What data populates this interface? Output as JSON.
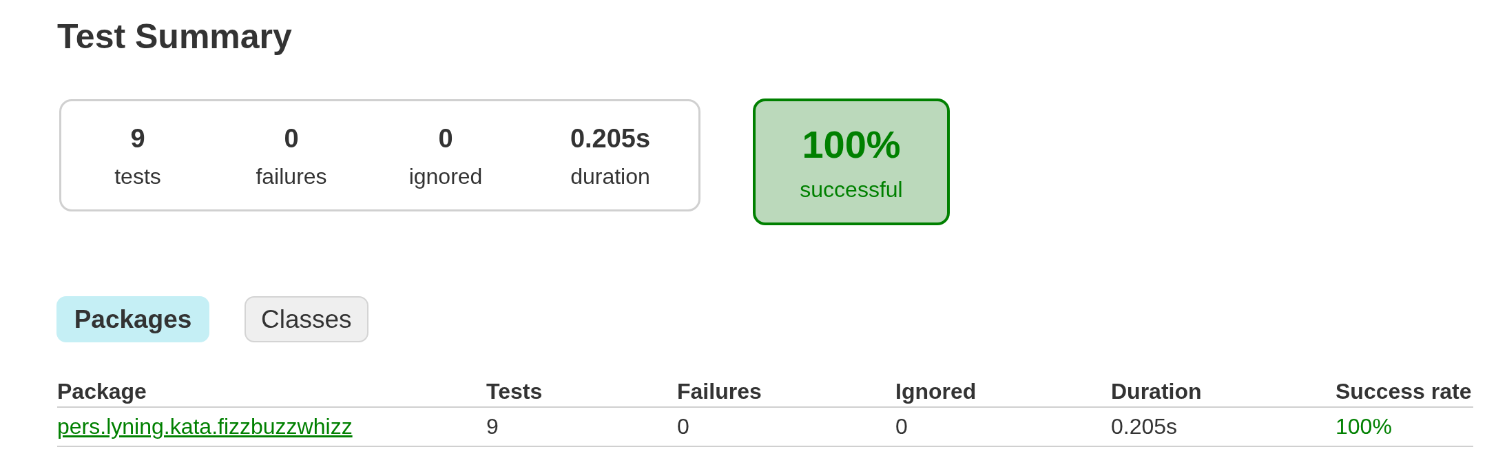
{
  "title": "Test Summary",
  "summary": {
    "counters": [
      {
        "value": "9",
        "label": "tests"
      },
      {
        "value": "0",
        "label": "failures"
      },
      {
        "value": "0",
        "label": "ignored"
      },
      {
        "value": "0.205s",
        "label": "duration"
      }
    ],
    "success_rate": {
      "value": "100%",
      "label": "successful",
      "passed": true
    }
  },
  "tabs": [
    {
      "label": "Packages",
      "selected": true
    },
    {
      "label": "Classes",
      "selected": false
    }
  ],
  "table": {
    "columns": [
      "Package",
      "Tests",
      "Failures",
      "Ignored",
      "Duration",
      "Success rate"
    ],
    "rows": [
      {
        "passed": true,
        "cells": [
          {
            "text": "pers.lyning.kata.fizzbuzzwhizz",
            "kind": "link"
          },
          {
            "text": "9",
            "kind": "text"
          },
          {
            "text": "0",
            "kind": "text"
          },
          {
            "text": "0",
            "kind": "text"
          },
          {
            "text": "0.205s",
            "kind": "text"
          },
          {
            "text": "100%",
            "kind": "rate"
          }
        ]
      }
    ]
  }
}
